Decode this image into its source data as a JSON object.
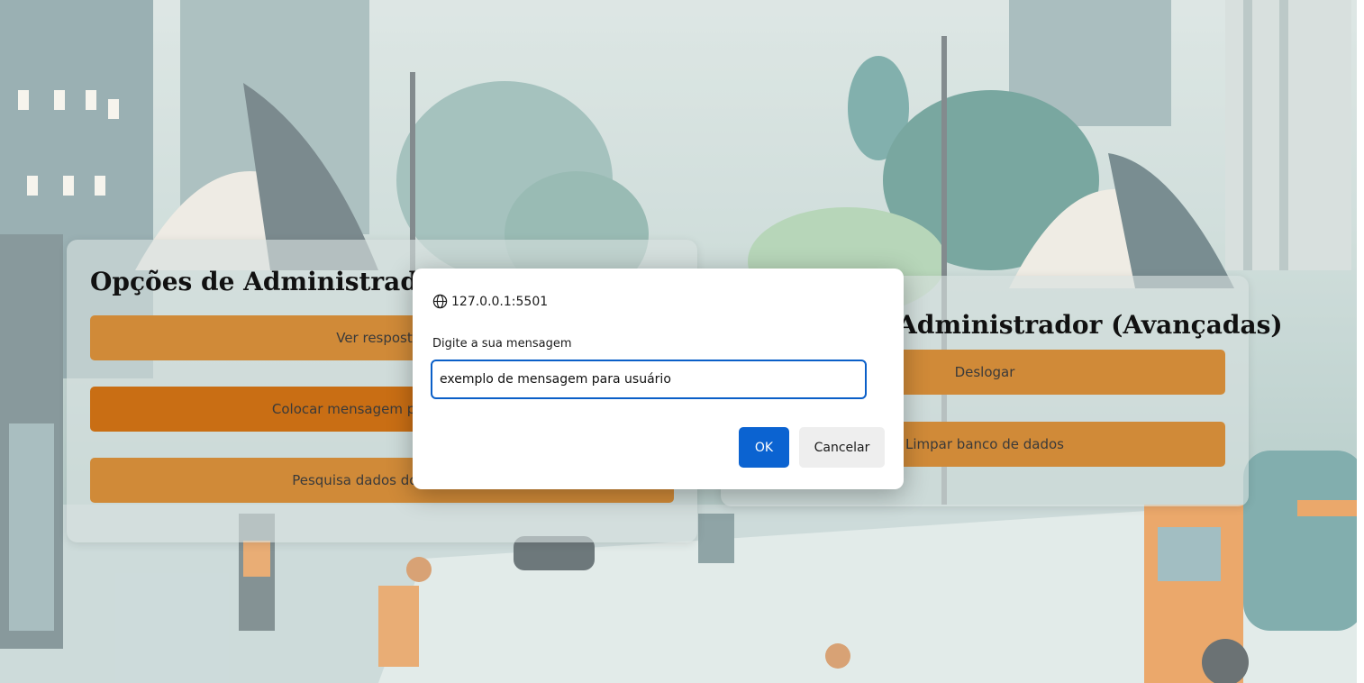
{
  "admin_panel": {
    "title": "Opções de Administrador",
    "buttons": [
      {
        "label": "Ver respostas"
      },
      {
        "label": "Colocar mensagem para usuário"
      },
      {
        "label": "Pesquisa dados do usuário"
      }
    ]
  },
  "advanced_panel": {
    "title": "Opções de Administrador (Avançadas)",
    "buttons": [
      {
        "label": "Deslogar"
      },
      {
        "label": "Limpar banco de dados"
      }
    ]
  },
  "prompt_dialog": {
    "origin": "127.0.0.1:5501",
    "message": "Digite a sua mensagem",
    "input_value": "exemplo de mensagem para usuário",
    "ok_label": "OK",
    "cancel_label": "Cancelar"
  },
  "colors": {
    "button_orange": "#d08a38",
    "button_orange_active": "#c96e14",
    "primary_blue": "#0b63d1"
  },
  "icons": {
    "origin_icon": "globe-icon"
  }
}
